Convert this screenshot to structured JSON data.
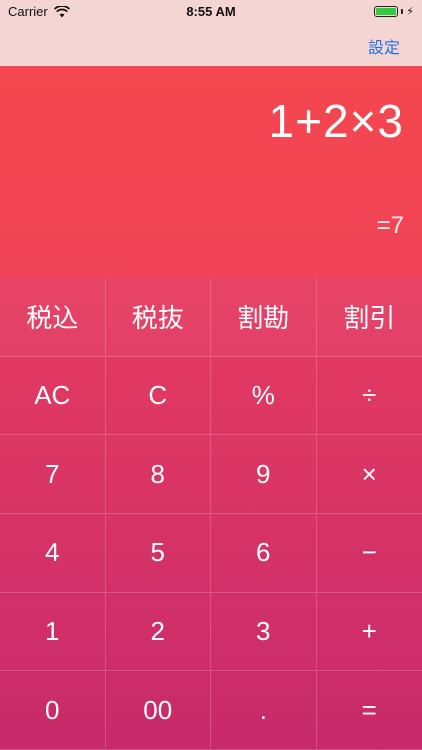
{
  "status": {
    "carrier": "Carrier",
    "time": "8:55 AM",
    "battery_level": 1.0
  },
  "nav": {
    "settings_label": "設定"
  },
  "display": {
    "expression": "1+2×3",
    "result": "=7"
  },
  "keys": [
    [
      "税込",
      "税抜",
      "割勘",
      "割引"
    ],
    [
      "AC",
      "C",
      "%",
      "÷"
    ],
    [
      "7",
      "8",
      "9",
      "×"
    ],
    [
      "4",
      "5",
      "6",
      "−"
    ],
    [
      "1",
      "2",
      "3",
      "+"
    ],
    [
      "0",
      "00",
      ".",
      "="
    ]
  ],
  "colors": {
    "nav_background": "#f5d4d4",
    "accent": "#1a73e8",
    "gradient_top": "#f2495a",
    "gradient_bottom": "#c72a6b"
  }
}
